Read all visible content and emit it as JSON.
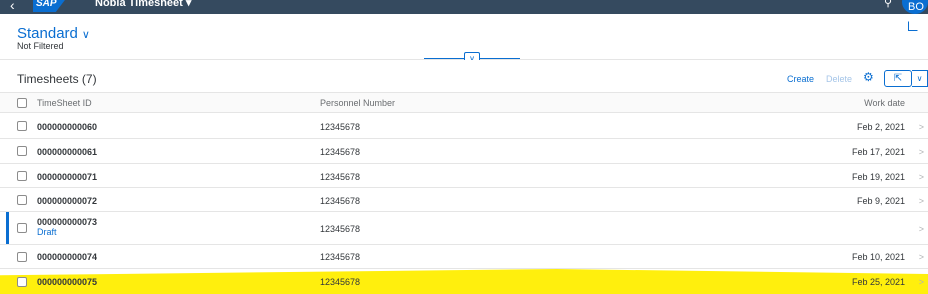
{
  "shell": {
    "back_icon": "chevron-left-icon",
    "logo_text": "SAP",
    "app_title": "Nobia Timesheet ▾",
    "search_icon": "search-icon",
    "avatar_initials": "BO"
  },
  "header": {
    "variant_name": "Standard",
    "variant_chevron": "∨",
    "filter_status": "Not Filtered",
    "collapse_glyph": "∨"
  },
  "table": {
    "title": "Timesheets (7)",
    "create_label": "Create",
    "delete_label": "Delete",
    "settings_glyph": "⚙",
    "export_glyph": "⇱",
    "export_more_glyph": "∨",
    "columns": [
      "TimeSheet ID",
      "Personnel Number",
      "Work date"
    ],
    "rows": [
      {
        "id": "000000000060",
        "status": "",
        "personnel": "12345678",
        "date": "Feb 2, 2021",
        "nav": ">"
      },
      {
        "id": "000000000061",
        "status": "",
        "personnel": "12345678",
        "date": "Feb 17, 2021",
        "nav": ">"
      },
      {
        "id": "000000000071",
        "status": "",
        "personnel": "12345678",
        "date": "Feb 19, 2021",
        "nav": ">"
      },
      {
        "id": "000000000072",
        "status": "",
        "personnel": "12345678",
        "date": "Feb 9, 2021",
        "nav": ">"
      },
      {
        "id": "000000000073",
        "status": "Draft",
        "personnel": "12345678",
        "date": "",
        "nav": ">"
      },
      {
        "id": "000000000074",
        "status": "",
        "personnel": "12345678",
        "date": "Feb 10, 2021",
        "nav": ">"
      },
      {
        "id": "000000000075",
        "status": "",
        "personnel": "12345678",
        "date": "Feb 25, 2021",
        "nav": ">"
      }
    ]
  },
  "colors": {
    "shell_bg": "#354a5f",
    "accent": "#0a6ed1",
    "highlight": "#ffee00"
  }
}
